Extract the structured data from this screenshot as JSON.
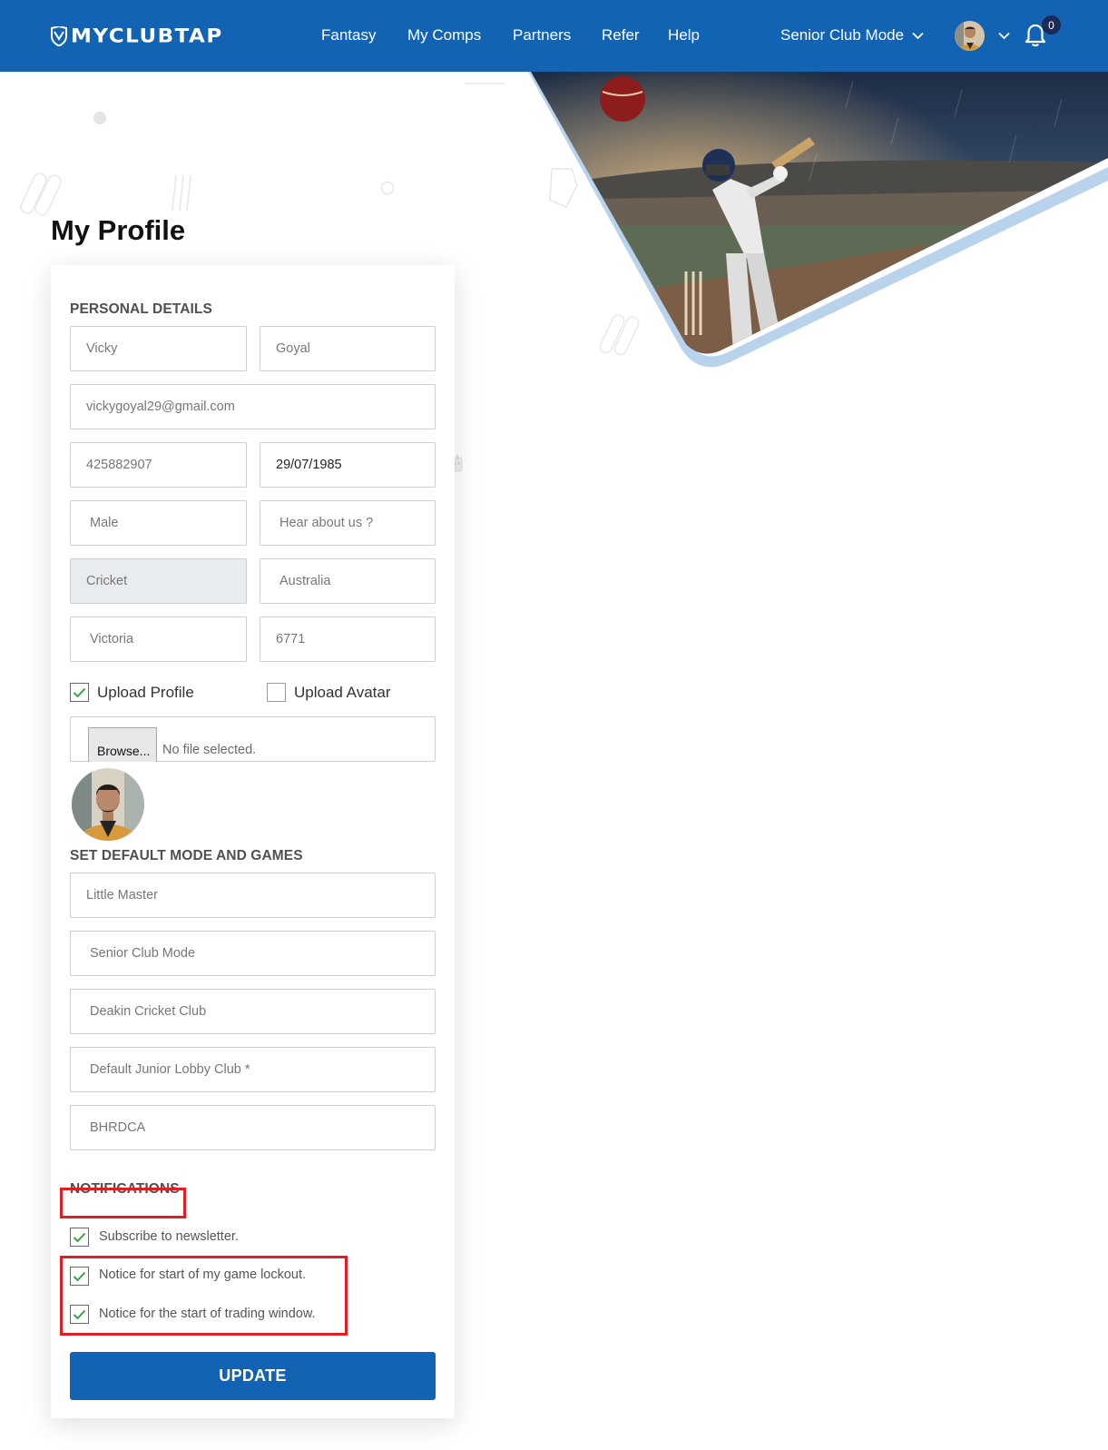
{
  "header": {
    "logo_text": "MYCLUBTAP",
    "nav": [
      "Fantasy",
      "My Comps",
      "Partners",
      "Refer",
      "Help"
    ],
    "mode_label": "Senior Club Mode",
    "notification_count": "0"
  },
  "page": {
    "title": "My Profile"
  },
  "personal": {
    "section_title": "PERSONAL DETAILS",
    "first_name": "Vicky",
    "last_name": "Goyal",
    "email": "vickygoyal29@gmail.com",
    "phone": "425882907",
    "dob": "29/07/1985",
    "gender": "Male",
    "hear_about": "Hear about us ?",
    "sport": "Cricket",
    "country": "Australia",
    "state": "Victoria",
    "postcode": "6771",
    "upload_profile_label": "Upload Profile",
    "upload_profile_checked": true,
    "upload_avatar_label": "Upload Avatar",
    "upload_avatar_checked": false,
    "browse_label": "Browse...",
    "file_status": "No file selected."
  },
  "defaults": {
    "section_title": "SET DEFAULT MODE AND GAMES",
    "game": "Little Master",
    "mode": "Senior Club Mode",
    "club": "Deakin Cricket Club",
    "junior_lobby": "Default Junior Lobby Club *",
    "association": "BHRDCA"
  },
  "notifications": {
    "section_title": "NOTIFICATIONS",
    "options": [
      {
        "label": "Subscribe to newsletter.",
        "checked": true
      },
      {
        "label": "Notice for start of my game lockout.",
        "checked": true
      },
      {
        "label": "Notice for the start of trading window.",
        "checked": true
      }
    ]
  },
  "actions": {
    "update_label": "UPDATE"
  },
  "colors": {
    "brand_blue": "#1263b3",
    "highlight_red": "#e01e26",
    "check_green": "#3aa04a",
    "badge_navy": "#1b2a57"
  }
}
